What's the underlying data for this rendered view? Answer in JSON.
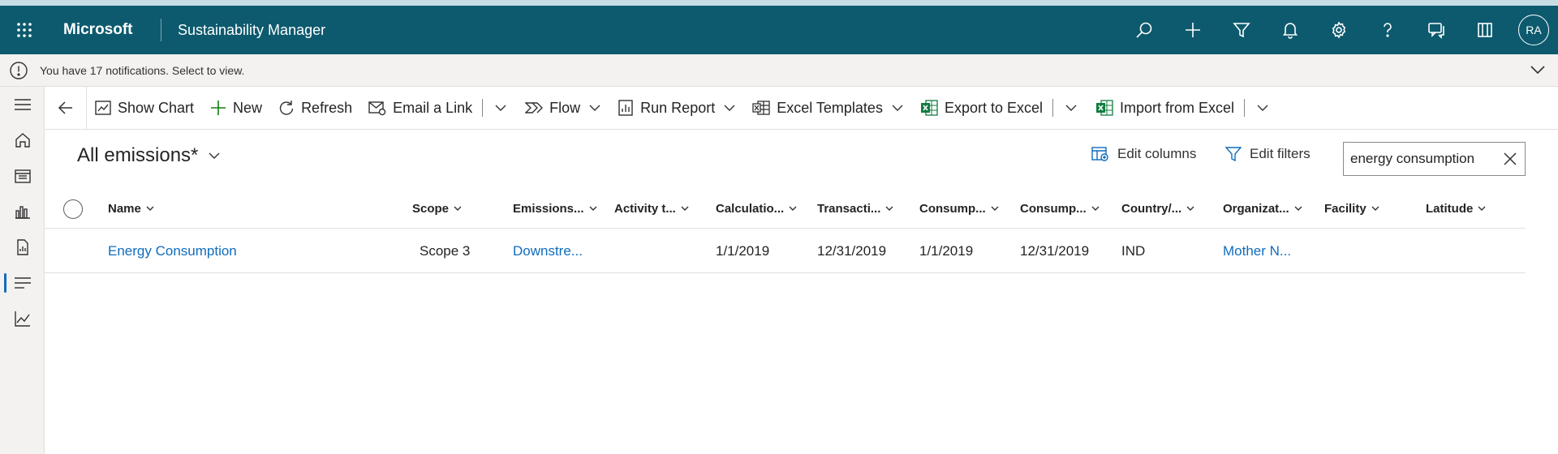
{
  "topbar": {
    "brand": "Microsoft",
    "app_name": "Sustainability Manager",
    "avatar_initials": "RA",
    "icons": [
      "search-icon",
      "add-icon",
      "filter-icon",
      "bell-icon",
      "gear-icon",
      "help-icon",
      "chat-icon",
      "book-icon"
    ],
    "background": "#0d5a6e"
  },
  "notification": {
    "text": "You have 17 notifications. Select to view."
  },
  "sidebar": {
    "items": [
      "home-icon",
      "calendar-icon",
      "chart-bars-icon",
      "report-icon",
      "list-icon",
      "analytics-icon"
    ],
    "active_index": 4
  },
  "commands": {
    "show_chart": "Show Chart",
    "new": "New",
    "refresh": "Refresh",
    "email_link": "Email a Link",
    "flow": "Flow",
    "run_report": "Run Report",
    "excel_templates": "Excel Templates",
    "export_excel": "Export to Excel",
    "import_excel": "Import from Excel"
  },
  "view": {
    "title": "All emissions*",
    "edit_columns": "Edit columns",
    "edit_filters": "Edit filters",
    "search_value": "energy consumption"
  },
  "grid": {
    "columns": [
      "Name",
      "Scope",
      "Emissions...",
      "Activity t...",
      "Calculatio...",
      "Transacti...",
      "Consump...",
      "Consump...",
      "Country/...",
      "Organizat...",
      "Facility",
      "Latitude"
    ],
    "rows": [
      {
        "name": "Energy Consumption",
        "scope": "Scope 3",
        "emissions": "Downstre...",
        "activity": "",
        "calculation": "1/1/2019",
        "transaction": "12/31/2019",
        "consumption_start": "1/1/2019",
        "consumption_end": "12/31/2019",
        "country": "IND",
        "organization": "Mother N...",
        "facility": "",
        "latitude": ""
      }
    ]
  },
  "colors": {
    "accent": "#0f6cbd",
    "excel_green": "#107c41",
    "new_green": "#107c10"
  }
}
